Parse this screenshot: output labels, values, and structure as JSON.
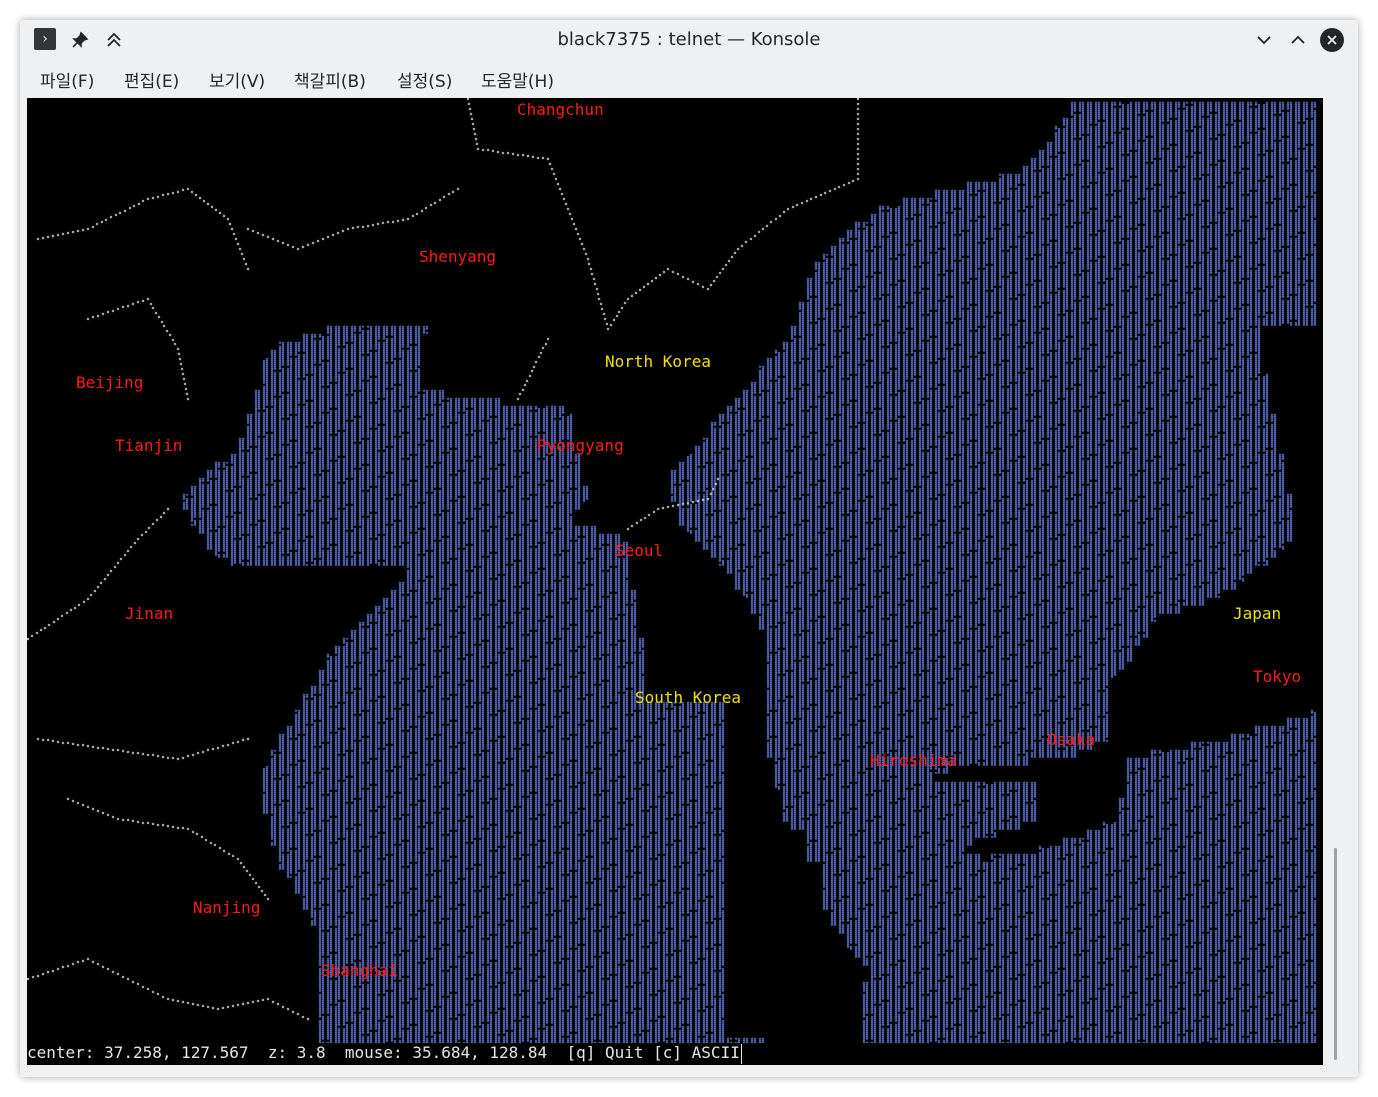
{
  "window": {
    "title": "black7375 : telnet — Konsole",
    "icons": [
      "terminal-icon",
      "pin-icon",
      "keep-above-icon",
      "minimize-icon",
      "maximize-icon",
      "close-icon"
    ]
  },
  "menu": {
    "items": [
      "파일(F)",
      "편집(E)",
      "보기(V)",
      "책갈피(B)",
      "설정(S)",
      "도움말(H)"
    ]
  },
  "map": {
    "countries": [
      {
        "name": "North Korea"
      },
      {
        "name": "South Korea"
      },
      {
        "name": "Japan"
      }
    ],
    "cities": [
      {
        "name": "Changchun"
      },
      {
        "name": "Shenyang"
      },
      {
        "name": "Beijing"
      },
      {
        "name": "Tianjin"
      },
      {
        "name": "Pyongyang"
      },
      {
        "name": "Seoul"
      },
      {
        "name": "Jinan"
      },
      {
        "name": "Tokyo"
      },
      {
        "name": "Osaka"
      },
      {
        "name": "Hiroshima"
      },
      {
        "name": "Nanjing"
      },
      {
        "name": "Shanghai"
      }
    ],
    "colors": {
      "water": "#6b7fe0",
      "border": "#d8d8d8",
      "city": "#ff1a1a",
      "country": "#f0e000",
      "background": "#000000"
    }
  },
  "status": {
    "text": "center: 37.258, 127.567  z: 3.8  mouse: 35.684, 128.84  [q] Quit [c] ASCII"
  }
}
